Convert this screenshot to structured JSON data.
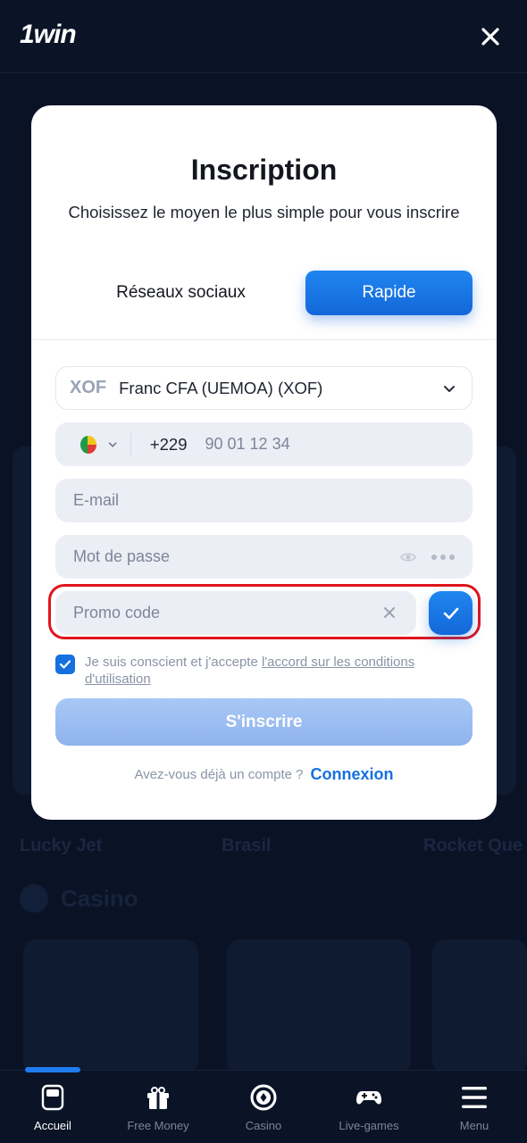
{
  "app": {
    "logo": "1win"
  },
  "modal": {
    "title": "Inscription",
    "subtitle": "Choisissez le moyen le plus simple pour vous inscrire",
    "tabs": {
      "social": "Réseaux sociaux",
      "quick": "Rapide",
      "active": "quick"
    },
    "currency": {
      "code": "XOF",
      "name": "Franc CFA (UEMOA) (XOF)"
    },
    "phone": {
      "prefix": "+229",
      "placeholder": "90 01 12 34"
    },
    "email": {
      "placeholder": "E-mail"
    },
    "password": {
      "placeholder": "Mot de passe"
    },
    "promo": {
      "placeholder": "Promo code"
    },
    "terms": {
      "text": "Je suis conscient et j'accepte ",
      "link": "l'accord sur les conditions d'utilisation",
      "checked": true
    },
    "submit_label": "S'inscrire",
    "login_question": "Avez-vous déjà un compte ?",
    "login_link": "Connexion"
  },
  "background": {
    "labels": [
      "Lucky Jet",
      "Brasil",
      "Rocket Que"
    ],
    "section_title": "Casino"
  },
  "bottom_nav": {
    "items": [
      {
        "label": "Accueil",
        "icon": "home-icon",
        "active": true
      },
      {
        "label": "Free Money",
        "icon": "gift-icon",
        "active": false
      },
      {
        "label": "Casino",
        "icon": "casino-chip-icon",
        "active": false
      },
      {
        "label": "Live-games",
        "icon": "gamepad-icon",
        "active": false
      },
      {
        "label": "Menu",
        "icon": "menu-icon",
        "active": false
      }
    ]
  },
  "colors": {
    "accent": "#1670e0",
    "highlight": "#e0141c",
    "background": "#0a1325"
  }
}
